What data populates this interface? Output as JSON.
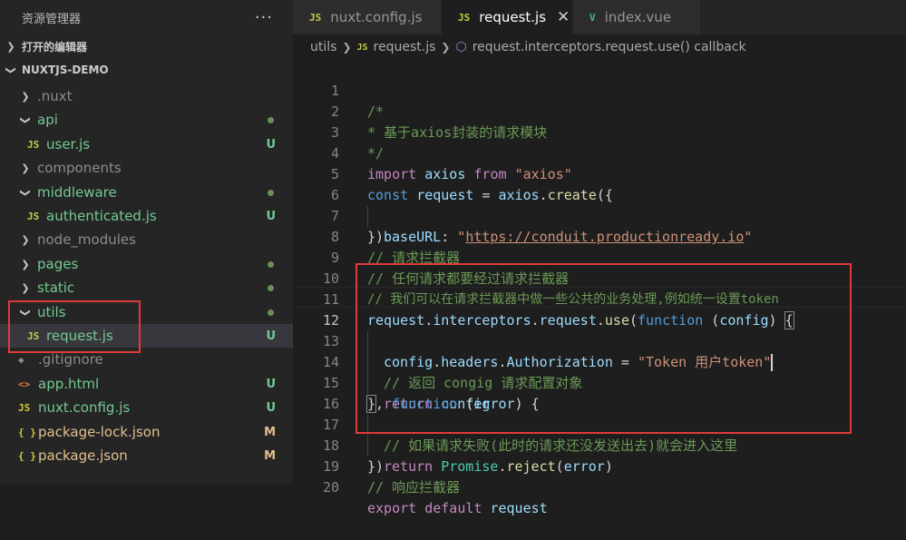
{
  "sidebar": {
    "title": "资源管理器",
    "more_icon": "···",
    "open_editors": "打开的编辑器",
    "project": "NUXTJS-DEMO",
    "items": [
      {
        "label": "  .nuxt",
        "kind": "folder",
        "expanded": false,
        "status": ""
      },
      {
        "label": "api",
        "kind": "folder",
        "expanded": true,
        "status": "dot"
      },
      {
        "label": "user.js",
        "kind": "js",
        "status": "U"
      },
      {
        "label": "components",
        "kind": "folder",
        "expanded": false,
        "status": ""
      },
      {
        "label": "middleware",
        "kind": "folder",
        "expanded": true,
        "status": "dot"
      },
      {
        "label": "authenticated.js",
        "kind": "js",
        "status": "U"
      },
      {
        "label": "node_modules",
        "kind": "folder",
        "expanded": false,
        "status": ""
      },
      {
        "label": "pages",
        "kind": "folder",
        "expanded": false,
        "status": "dot"
      },
      {
        "label": "static",
        "kind": "folder",
        "expanded": false,
        "status": "dot"
      },
      {
        "label": "utils",
        "kind": "folder",
        "expanded": true,
        "status": "dot"
      },
      {
        "label": "request.js",
        "kind": "js",
        "status": "U"
      },
      {
        "label": ".gitignore",
        "kind": "git",
        "status": ""
      },
      {
        "label": "app.html",
        "kind": "html",
        "status": "U"
      },
      {
        "label": "nuxt.config.js",
        "kind": "js",
        "status": "U"
      },
      {
        "label": "package-lock.json",
        "kind": "json",
        "status": "M"
      },
      {
        "label": "package.json",
        "kind": "json",
        "status": "M"
      }
    ]
  },
  "tabs": [
    {
      "label": "nuxt.config.js",
      "icon": "JS"
    },
    {
      "label": "request.js",
      "icon": "JS",
      "close": "✕"
    },
    {
      "label": "index.vue",
      "icon": "V"
    }
  ],
  "breadcrumb": {
    "folder": "utils",
    "file_icon": "JS",
    "file": "request.js",
    "symbol": "request.interceptors.request.use() callback"
  },
  "file_icon_text": {
    "js": "JS",
    "json": "{ }",
    "html": "<>",
    "git": "◆"
  },
  "colors": {
    "untracked": "#73c991",
    "modified": "#e2c08d",
    "highlight_box": "#e03a3a"
  },
  "code": {
    "line_numbers": [
      "1",
      "2",
      "3",
      "4",
      "5",
      "6",
      "7",
      "8",
      "9",
      "10",
      "11",
      "12",
      "13",
      "14",
      "15",
      "16",
      "17",
      "18",
      "19",
      "20"
    ],
    "l1": "/*",
    "l2": "* 基于axios封装的请求模块",
    "l3": "*/",
    "l4": [
      "import",
      "axios",
      "from",
      "\"axios\""
    ],
    "l5": [
      "const",
      "request",
      "=",
      "axios",
      ".",
      "create",
      "({"
    ],
    "l6": [
      "baseURL",
      ":",
      "\"",
      "https://conduit.productionready.io",
      "\""
    ],
    "l7": "})",
    "l8": "// 请求拦截器",
    "l9": "// 任何请求都要经过请求拦截器",
    "l10": "// 我们可以在请求拦截器中做一些公共的业务处理,例如统一设置token",
    "l11": [
      "request",
      ".",
      "interceptors",
      ".",
      "request",
      ".",
      "use",
      "(",
      "function",
      " (",
      "config",
      ") ",
      "{"
    ],
    "l12": [
      "config",
      ".",
      "headers",
      ".",
      "Authorization",
      " = ",
      "\"Token 用户token\""
    ],
    "l13": "// 返回 congig 请求配置对象",
    "l14": [
      "return",
      "config"
    ],
    "l15": [
      "}",
      ", ",
      "function",
      " (",
      "error",
      ") {"
    ],
    "l16": "// 如果请求失败(此时的请求还没发送出去)就会进入这里",
    "l17": [
      "return",
      "Promise",
      ".",
      "reject",
      "(",
      "error",
      ")"
    ],
    "l18": "})",
    "l19": "// 响应拦截器",
    "l20": [
      "export",
      "default",
      "request"
    ]
  }
}
